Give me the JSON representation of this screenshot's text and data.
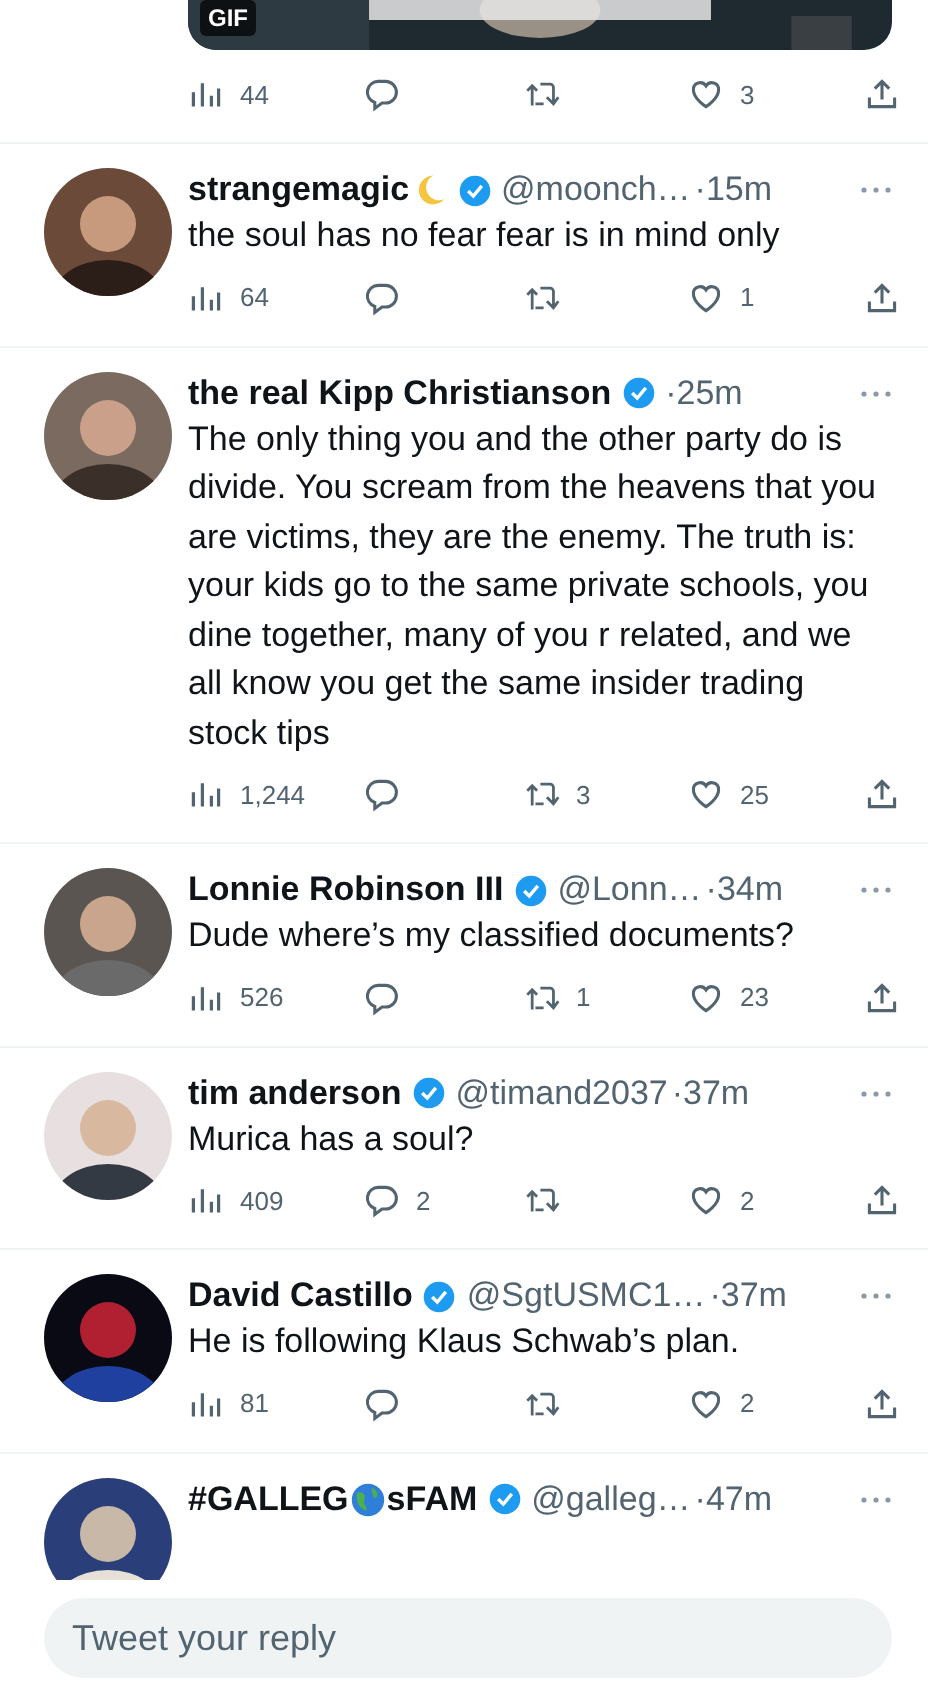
{
  "top_tweet": {
    "media": {
      "kind": "picture",
      "badge": "GIF"
    },
    "views": "44",
    "likes": "3"
  },
  "tweets": [
    {
      "kind": "moon",
      "name": "strangemagic",
      "verified": true,
      "handle": "@moonch…",
      "time": "·15m",
      "text": "the soul has no fear  fear is in mind only",
      "views": "64",
      "likes": "1"
    },
    {
      "kind": "plain",
      "name": "the real Kipp Christianson",
      "verified": true,
      "time": "·25m",
      "text": "The only thing you and the other party do is divide. You scream from the heavens that you are victims, they are the enemy. The truth is: your kids go to the same private schools, you dine together, many of you r related, and we all know you get the same insider trading stock tips",
      "views": "1,244",
      "retweets": "3",
      "likes": "25"
    },
    {
      "kind": "plain",
      "name": "Lonnie Robinson III",
      "verified": true,
      "handle": "@Lonn…",
      "time": "·34m",
      "text": "Dude where’s my classified documents?",
      "views": "526",
      "retweets": "1",
      "likes": "23"
    },
    {
      "kind": "plain",
      "name": "tim anderson",
      "verified": true,
      "handle": "@timand2037",
      "time": "·37m",
      "text": "Murica has a soul?",
      "views": "409",
      "replies": "2",
      "likes": "2"
    },
    {
      "kind": "plain",
      "name": "David Castillo",
      "verified": true,
      "handle": "@SgtUSMC1…",
      "time": "·37m",
      "text": "He is following Klaus Schwab’s plan.",
      "views": "81",
      "likes": "2"
    },
    {
      "kind": "globe",
      "name": "#GALLEG",
      "name_after": "sFAM",
      "verified": true,
      "handle": "@galleg…",
      "time": "·47m"
    }
  ],
  "reply_field": {
    "placeholder": "Tweet your reply"
  }
}
